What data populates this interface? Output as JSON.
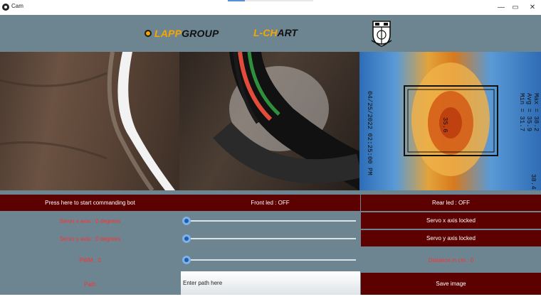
{
  "window": {
    "title": "Cam"
  },
  "header": {
    "logo1_part1": "LAPP",
    "logo1_part2": "GROUP",
    "logo2_part1": "L-C",
    "logo2_part2": "H",
    "logo2_part3": "ART"
  },
  "controls": {
    "start_button": "Press here to start commanding bot",
    "front_led": "Front led : OFF",
    "rear_led": "Rear led : OFF",
    "servo_x_label": "Servo x axis : 0 degrees",
    "servo_y_label": "Servo y axis : 0 degrees",
    "servo_x_lock": "Servo x axis locked",
    "servo_y_lock": "Servo y axis locked",
    "pwm_label": "PWM : 0",
    "distance_label": "Distance in cm : 0",
    "path_label": "Path",
    "path_placeholder": "Enter path here",
    "save_button": "Save image"
  },
  "sliders": {
    "servo_x": 0,
    "servo_y": 0,
    "pwm": 0
  },
  "thermal": {
    "max": "Max = 38.2",
    "avg": "Avg = 35.9",
    "min": "Min = 31.7",
    "center": "35.6",
    "timestamp": "04/25/2022 02:25:00 PM",
    "corner": "38.4"
  },
  "colors": {
    "panel": "#6d8591",
    "button": "#5c0000",
    "label_red": "#ff3030",
    "accent": "#f7a600"
  },
  "icons": [
    "app-icon",
    "gear-icon",
    "crest-icon",
    "minimize-icon",
    "maximize-icon",
    "close-icon"
  ]
}
